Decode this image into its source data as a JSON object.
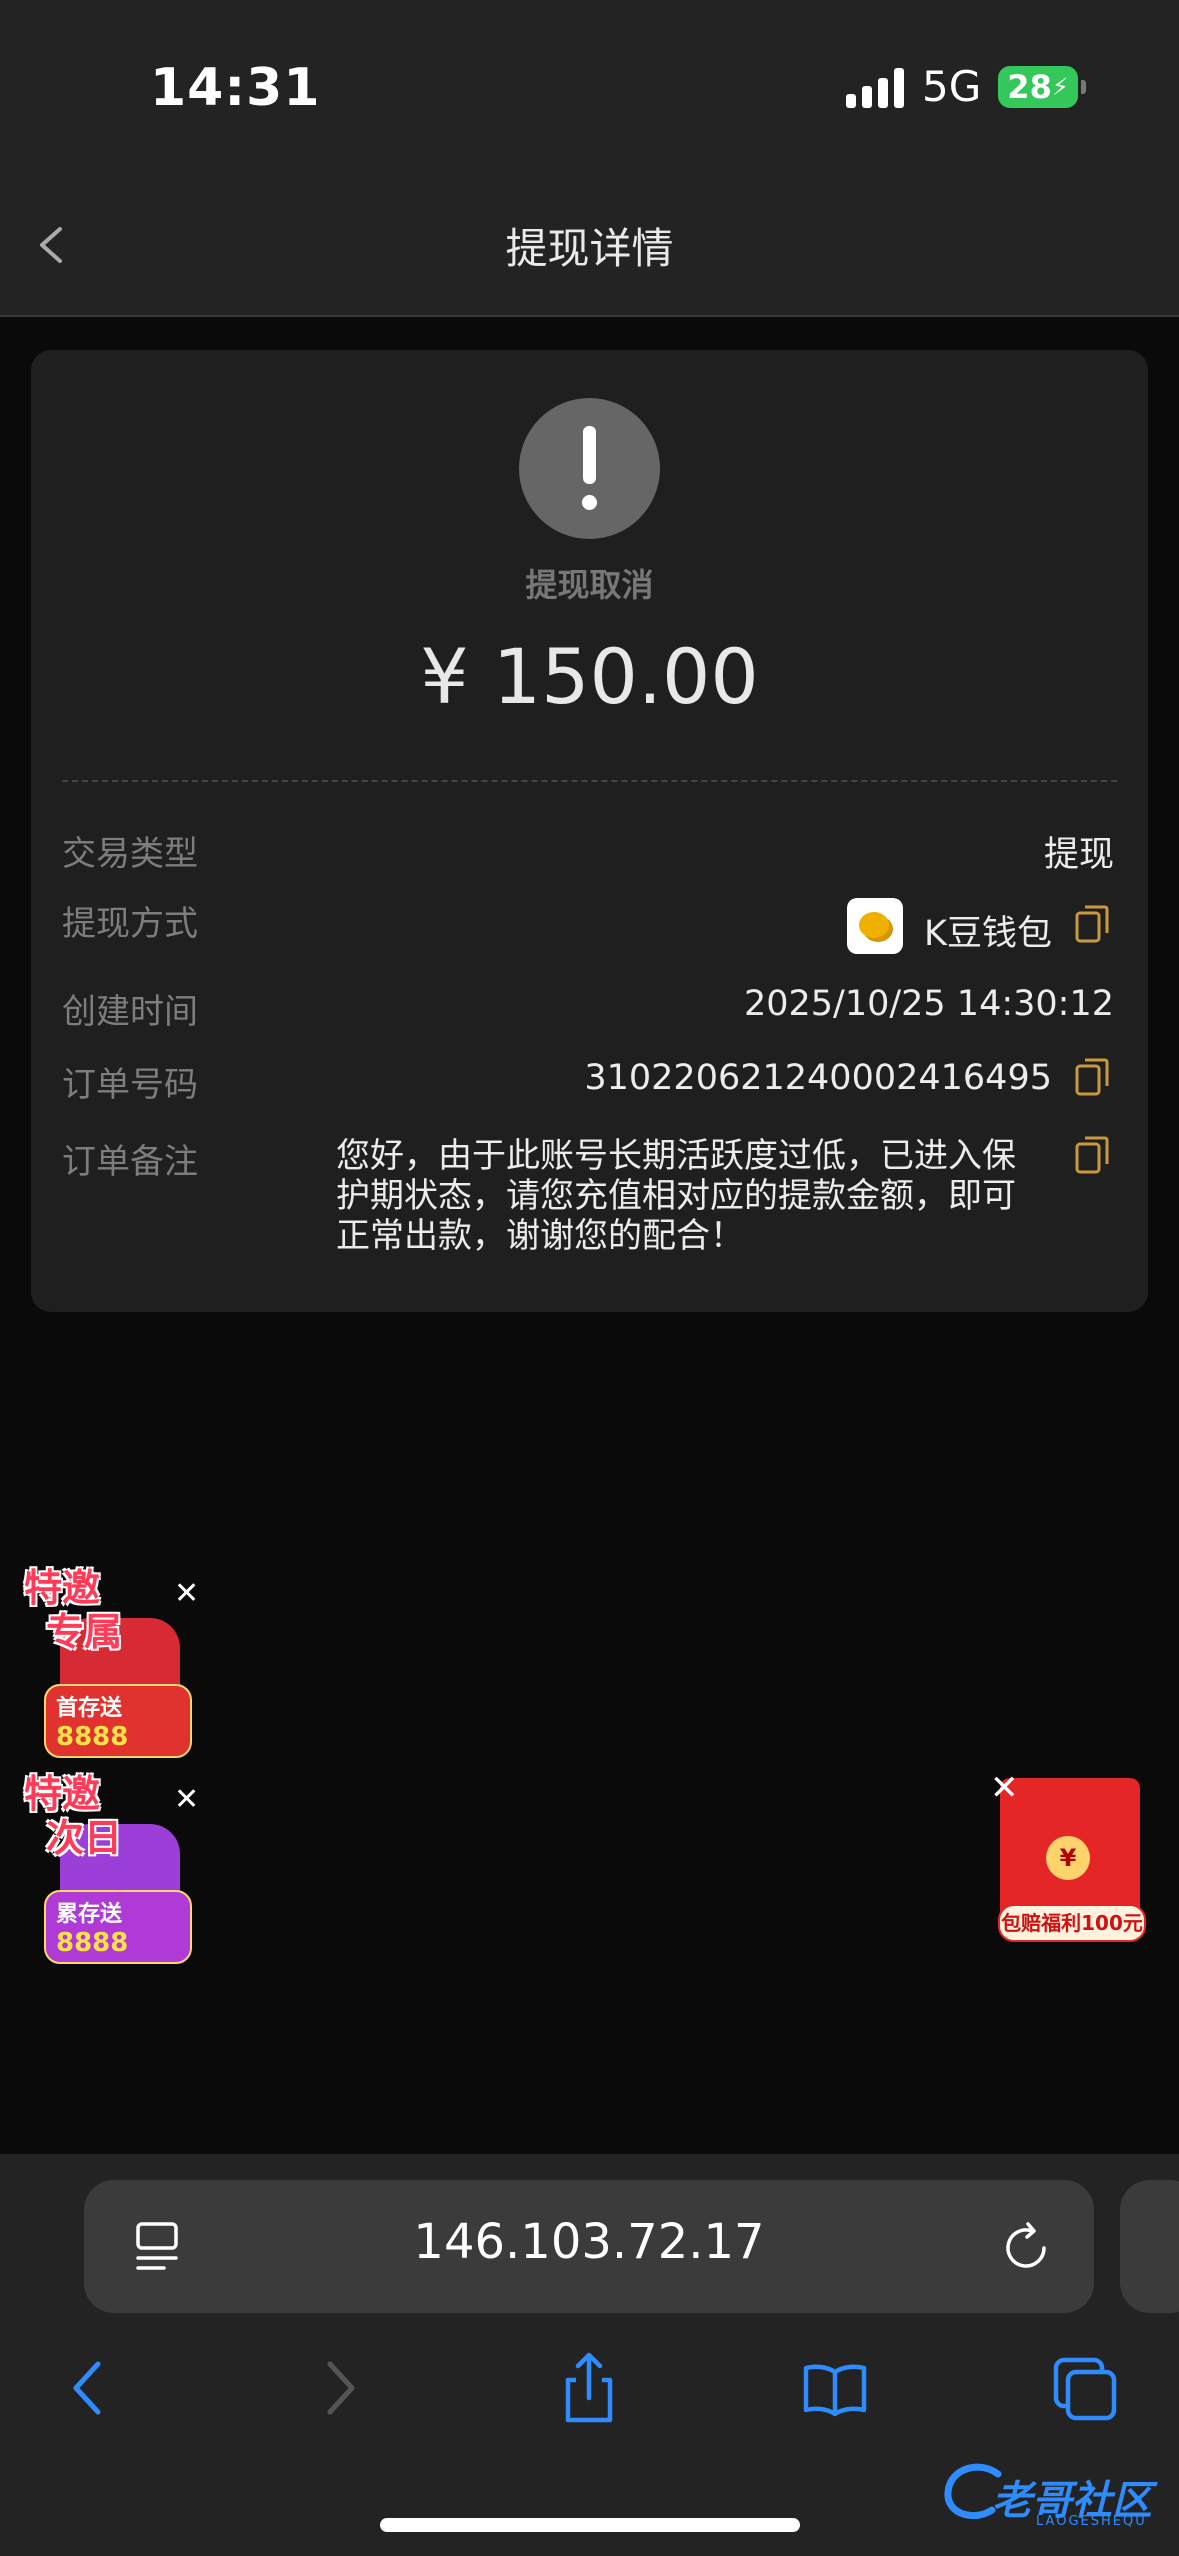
{
  "status_bar": {
    "time": "14:31",
    "network": "5G",
    "battery": "28"
  },
  "nav": {
    "title": "提现详情"
  },
  "summary": {
    "status": "提现取消",
    "amount": "¥ 150.00"
  },
  "details": [
    {
      "label": "交易类型",
      "value": "提现"
    },
    {
      "label": "提现方式",
      "value": "K豆钱包"
    },
    {
      "label": "创建时间",
      "value": "2025/10/25 14:30:12"
    },
    {
      "label": "订单号码",
      "value": "3102206212400024164​95"
    },
    {
      "label": "订单备注",
      "value": "您好，由于此账号长期活跃度过低，已进入保护期状态，请您充值相对应的提款金额，即可正常出款，谢谢您的配合！"
    }
  ],
  "ads": [
    {
      "title_line1": "特邀",
      "title_line2": "专属",
      "badge_prefix": "首存送",
      "badge_amount": "8888",
      "color": "#d62a35"
    },
    {
      "title_line1": "特邀",
      "title_line2": "次日",
      "badge_prefix": "累存送",
      "badge_amount": "8888",
      "color": "#9b3fd8"
    }
  ],
  "red_packet": {
    "coin": "¥",
    "label": "包赔福利100元"
  },
  "browser": {
    "url": "146.103.72.17"
  },
  "watermark": {
    "text": "老哥社区",
    "sub": "LAOGESHEQU"
  }
}
